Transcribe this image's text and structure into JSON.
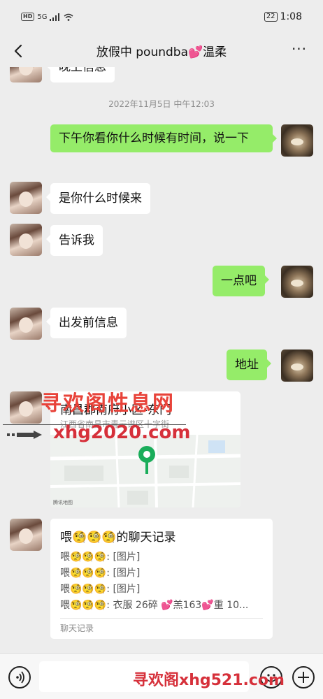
{
  "status_bar": {
    "network": "5G",
    "hd_badge": "HD",
    "battery": "22",
    "time": "1:08"
  },
  "header": {
    "title": "放假中 poundba💕温柔"
  },
  "messages": {
    "partial_top": "晚上信息",
    "timestamp": "2022年11月5日 中午12:03",
    "m1": "下午你看你什么时候有时间，说一下",
    "m2": "是你什么时候来",
    "m3": "告诉我",
    "m4": "一点吧",
    "m5": "出发前信息",
    "m6": "地址"
  },
  "location": {
    "title": "南昌郡南府小区-东门",
    "address": "江西省南昌市青云谱区十字街",
    "map_credit": "腾讯地图"
  },
  "chat_record": {
    "title": "喂🧐🧐🧐的聊天记录",
    "lines": [
      "喂🧐🧐🧐: [图片]",
      "喂🧐🧐🧐: [图片]",
      "喂🧐🧐🧐: [图片]",
      "喂🧐🧐🧐: 衣服 26碎 💕羔163💕重 10..."
    ],
    "footer": "聊天记录"
  },
  "watermarks": {
    "middle": "寻欢阁性息网",
    "url": "xhg2020.com",
    "bottom": "寻欢阁xhg521.com"
  },
  "colors": {
    "background": "#ededed",
    "own_bubble": "#95ec69",
    "other_bubble": "#ffffff",
    "pin": "#1aad5a",
    "watermark": "#d6303a"
  }
}
